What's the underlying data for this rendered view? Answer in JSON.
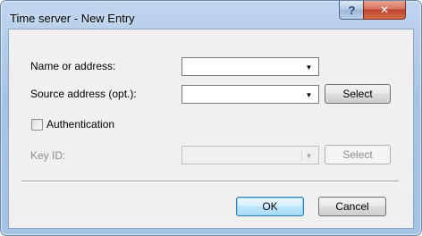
{
  "window": {
    "title": "Time server - New Entry",
    "help_label": "?",
    "close_label": "✕"
  },
  "form": {
    "name_label": "Name or address:",
    "name_value": "",
    "source_label": "Source address (opt.):",
    "source_value": "",
    "source_select_label": "Select",
    "auth_label": "Authentication",
    "auth_checked": false,
    "keyid_label": "Key ID:",
    "keyid_value": "",
    "keyid_select_label": "Select"
  },
  "buttons": {
    "ok_label": "OK",
    "cancel_label": "Cancel"
  },
  "icons": {
    "dropdown": "chevron-down-icon",
    "help": "help-icon",
    "close": "close-icon"
  }
}
